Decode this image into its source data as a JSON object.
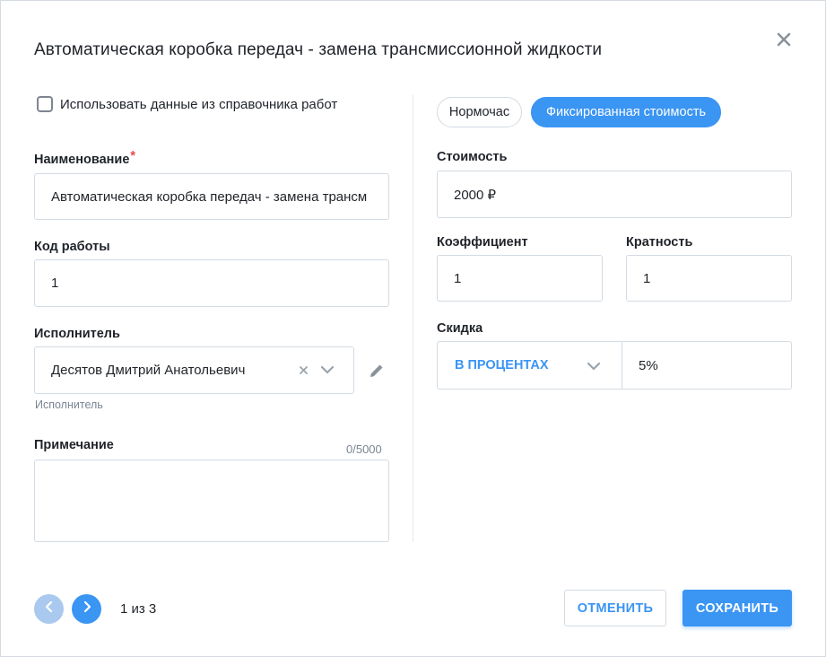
{
  "dialog": {
    "title": "Автоматическая коробка передач - замена трансмиссионной жидкости"
  },
  "use_directory": {
    "label": "Использовать данные из справочника работ",
    "checked": false
  },
  "name_field": {
    "label": "Наименование",
    "required_mark": "*",
    "value": "Автоматическая коробка передач - замена трансм"
  },
  "work_code": {
    "label": "Код работы",
    "value": "1"
  },
  "executor": {
    "label": "Исполнитель",
    "value": "Десятов Дмитрий Анатольевич",
    "hint": "Исполнитель"
  },
  "note": {
    "label": "Примечание",
    "counter": "0/5000",
    "value": ""
  },
  "pricing_tabs": {
    "normhour": "Нормочас",
    "fixed": "Фиксированная стоимость",
    "active": "fixed"
  },
  "cost": {
    "label": "Стоимость",
    "value": "2000 ₽"
  },
  "coefficient": {
    "label": "Коэффициент",
    "value": "1"
  },
  "multiplicity": {
    "label": "Кратность",
    "value": "1"
  },
  "discount": {
    "label": "Скидка",
    "type": "В ПРОЦЕНТАХ",
    "value": "5%"
  },
  "pagination": {
    "text": "1 из 3"
  },
  "actions": {
    "cancel": "ОТМЕНИТЬ",
    "save": "СОХРАНИТЬ"
  },
  "colors": {
    "accent": "#3a95f3",
    "required": "#e5484d",
    "border": "#d3dbe3"
  }
}
